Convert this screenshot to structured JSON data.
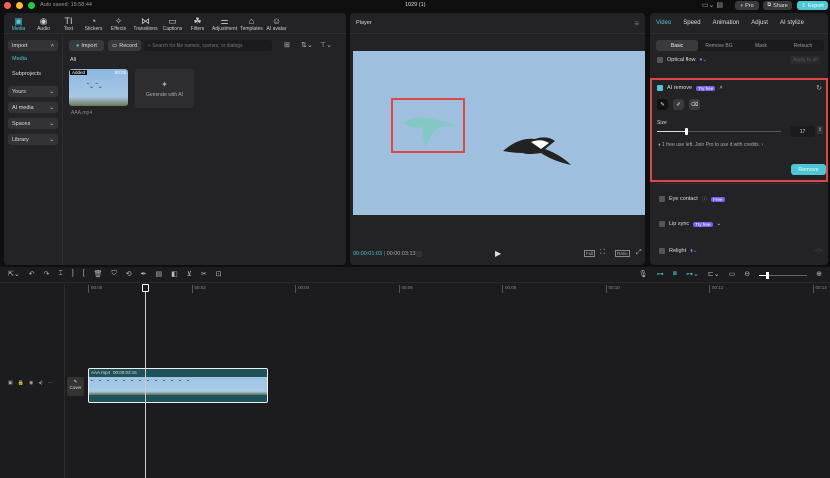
{
  "app": {
    "autosave": "Auto saved: 15:58:44",
    "project_title": "1029 (1)",
    "pro_label": "Pro",
    "share_label": "Share",
    "export_label": "Export"
  },
  "toolbar": [
    {
      "label": "Media",
      "icon": "media-icon",
      "glyph": "▣"
    },
    {
      "label": "Audio",
      "icon": "audio-icon",
      "glyph": "◉"
    },
    {
      "label": "Text",
      "icon": "text-icon",
      "glyph": "TI"
    },
    {
      "label": "Stickers",
      "icon": "sticker-icon",
      "glyph": "◔"
    },
    {
      "label": "Effects",
      "icon": "effects-icon",
      "glyph": "✧"
    },
    {
      "label": "Transitions",
      "icon": "transitions-icon",
      "glyph": "⋈"
    },
    {
      "label": "Captions",
      "icon": "captions-icon",
      "glyph": "▭"
    },
    {
      "label": "Filters",
      "icon": "filters-icon",
      "glyph": "☘"
    },
    {
      "label": "Adjustment",
      "icon": "adjustment-icon",
      "glyph": "⚌"
    },
    {
      "label": "Templates",
      "icon": "templates-icon",
      "glyph": "⌂"
    },
    {
      "label": "AI avatar",
      "icon": "avatar-icon",
      "glyph": "☺"
    }
  ],
  "sidebar": {
    "import": "Import",
    "media": "Media",
    "subprojects": "Subprojects",
    "yours": "Yours",
    "ai_media": "AI media",
    "spaces": "Spaces",
    "library": "Library"
  },
  "media": {
    "import_btn": "Import",
    "record_btn": "Record",
    "search_placeholder": "Search for file names, scenes, or dialogs",
    "filter_all": "All",
    "clip_badge": "Added",
    "clip_duration": "00:05",
    "clip_name": "AAA.mp4",
    "generate": "Generate with AI"
  },
  "player": {
    "title": "Player",
    "current_time": "00:00:01:03",
    "total_time": "00:00:03:13",
    "full": "Full",
    "ratio": "Ratio"
  },
  "inspector": {
    "tabs": [
      "Video",
      "Speed",
      "Animation",
      "Adjust",
      "AI stylize"
    ],
    "subtabs": [
      "Basic",
      "Remove BG",
      "Mask",
      "Retouch"
    ],
    "optical_flow": "Optical flow",
    "apply_all": "Apply to all",
    "ai_remove": "AI remove",
    "try_free": "Try free",
    "size_label": "Size",
    "size_value": "17",
    "size_fraction": 0.23,
    "credit_note": "1 free use left. Join Pro to use it with credits.",
    "remove_btn": "Remove",
    "eye_contact": "Eye contact",
    "free": "Free",
    "lip_sync": "Lip sync",
    "relight": "Relight"
  },
  "timeline": {
    "ticks": [
      "00:00",
      "00:02",
      "00:04",
      "00:06",
      "00:08",
      "00:10",
      "00:12",
      "00:14"
    ],
    "clip_name": "AAA.mp4",
    "clip_duration": "00:00:03:15",
    "cover": "Cover",
    "zoom_fraction": 0.15
  },
  "colors": {
    "accent": "#4fc6d6",
    "highlight": "#e04545",
    "pro": "#7b5cf0"
  }
}
